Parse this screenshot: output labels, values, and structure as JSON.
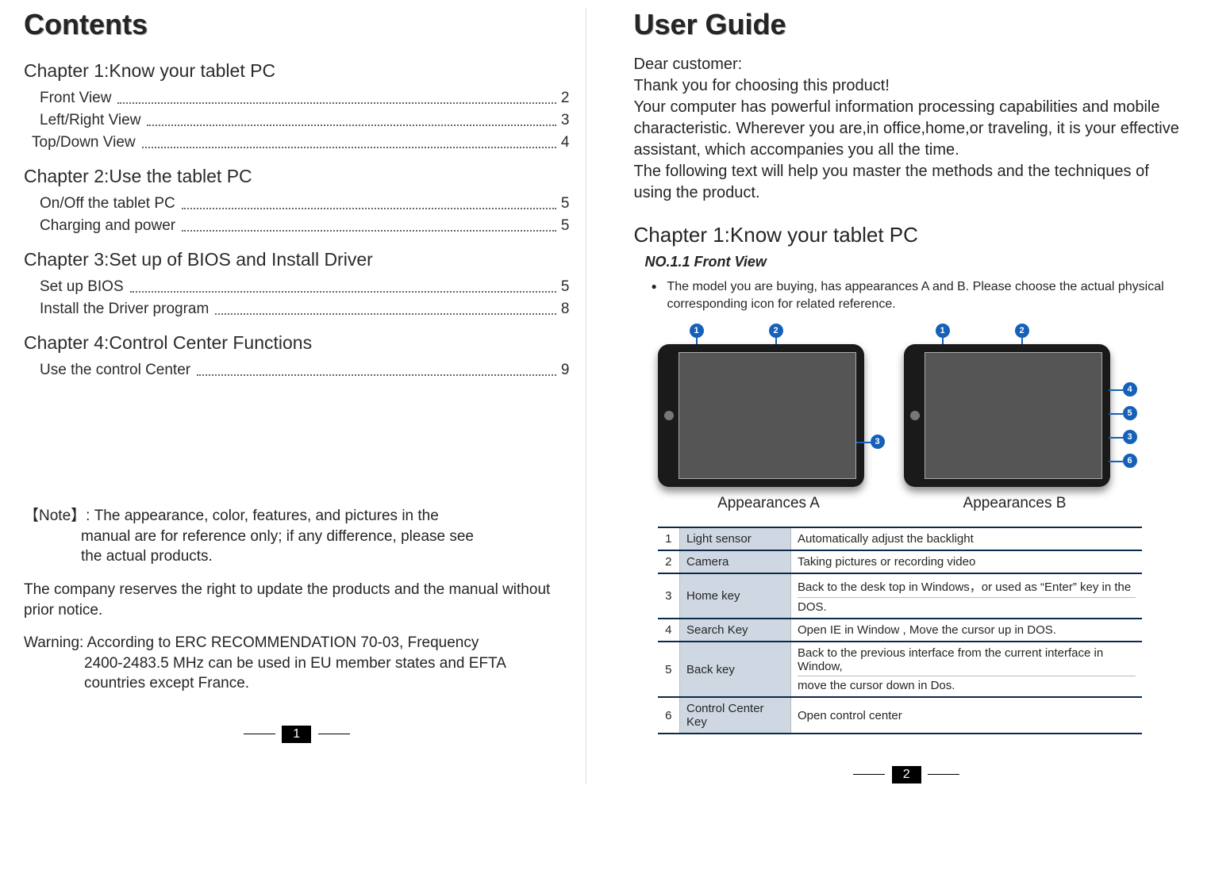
{
  "left": {
    "title": "Contents",
    "chapter1": {
      "title": "Chapter 1:Know your tablet PC",
      "items": [
        {
          "label": "Front View",
          "pg": "2"
        },
        {
          "label": "Left/Right View",
          "pg": "3"
        },
        {
          "label": "Top/Down View",
          "pg": "4"
        }
      ]
    },
    "chapter2": {
      "title": "Chapter 2:Use the tablet PC",
      "items": [
        {
          "label": "On/Off the tablet PC",
          "pg": "5"
        },
        {
          "label": "Charging and power",
          "pg": "5"
        }
      ]
    },
    "chapter3": {
      "title": "Chapter 3:Set up of BIOS and Install Driver",
      "items": [
        {
          "label": "Set up BIOS",
          "pg": "5"
        },
        {
          "label": "Install the Driver program",
          "pg": "8"
        }
      ]
    },
    "chapter4": {
      "title": "Chapter 4:Control Center Functions",
      "items": [
        {
          "label": "Use the control Center",
          "pg": "9"
        }
      ]
    },
    "note": {
      "lead": "【Note】: ",
      "line1": "The appearance, color, features, and pictures in the",
      "line2": "manual are for reference only; if any difference, please see",
      "line3": "the actual products."
    },
    "reserve": "The company reserves the right to update the products and the manual without prior notice.",
    "warning": {
      "line1": "Warning: According to ERC RECOMMENDATION 70-03, Frequency",
      "line2": "2400-2483.5 MHz can be used in EU member states and EFTA",
      "line3": "countries except France."
    },
    "pageNum": "1"
  },
  "right": {
    "title": "User Guide",
    "intro": "Dear customer:\nThank you for choosing this product!\nYour computer has powerful information processing capabilities and mobile characteristic. Wherever you are,in office,home,or traveling, it is your effective assistant, which accompanies you all the time.\nThe following text will help you master the methods and the techniques of using the product.",
    "chapterHead": "Chapter 1:Know your tablet PC",
    "subhead": "NO.1.1 Front View",
    "bullet": "The model you are buying, has appearances A and B. Please choose the actual physical corresponding icon for related reference.",
    "appearanceA": "Appearances A",
    "appearanceB": "Appearances B",
    "calloutsA": [
      "1",
      "2",
      "3"
    ],
    "calloutsB": [
      "1",
      "2",
      "3",
      "4",
      "5",
      "6"
    ],
    "table": [
      {
        "num": "1",
        "name": "Light sensor",
        "desc": "Automatically adjust the backlight"
      },
      {
        "num": "2",
        "name": "Camera",
        "desc": "Taking pictures or recording video"
      },
      {
        "num": "3",
        "name": "Home key",
        "descA": "Back to the desk top in Windows，or used as “Enter” key in the",
        "descB": "DOS."
      },
      {
        "num": "4",
        "name": "Search Key",
        "desc": "Open IE in Window , Move the cursor up in DOS."
      },
      {
        "num": "5",
        "name": "Back key",
        "descA": "Back to the previous interface from the current interface in Window,",
        "descB": "move the cursor down in Dos."
      },
      {
        "num": "6",
        "name": "Control Center Key",
        "desc": "Open control center"
      }
    ],
    "pageNum": "2"
  }
}
